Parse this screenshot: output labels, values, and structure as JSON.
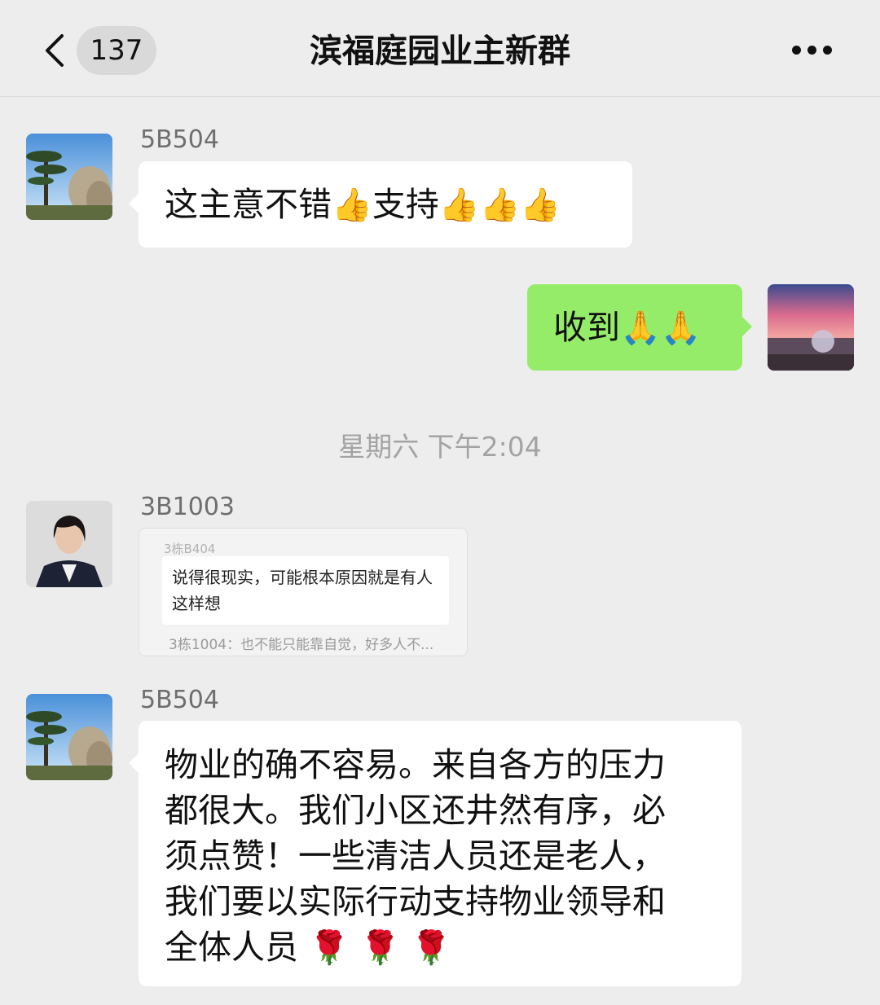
{
  "header": {
    "back_count": "137",
    "title": "滨福庭园业主新群"
  },
  "messages": [
    {
      "sender": "5B504",
      "text": "这主意不错",
      "emoji_a": "👍",
      "text_b": "支持",
      "emoji_b": "👍👍👍"
    },
    {
      "self": true,
      "text": "收到",
      "emoji": "🙏🙏"
    },
    {
      "sender": "3B1003",
      "quote": {
        "top": "3栋B404",
        "body": "说得很现实，可能根本原因就是有人这样想",
        "bottom": "3栋1004：也不能只能靠自觉，好多人不..."
      }
    },
    {
      "sender": "5B504",
      "lines": [
        "物业的确不容易。来自各方的压力",
        "都很大。我们小区还井然有序，必",
        "须点赞！一些清洁人员还是老人，",
        "我们要以实际行动支持物业领导和"
      ],
      "last_line": "全体人员",
      "emoji": "🌹 🌹 🌹"
    }
  ],
  "timestamp": "星期六 下午2:04"
}
